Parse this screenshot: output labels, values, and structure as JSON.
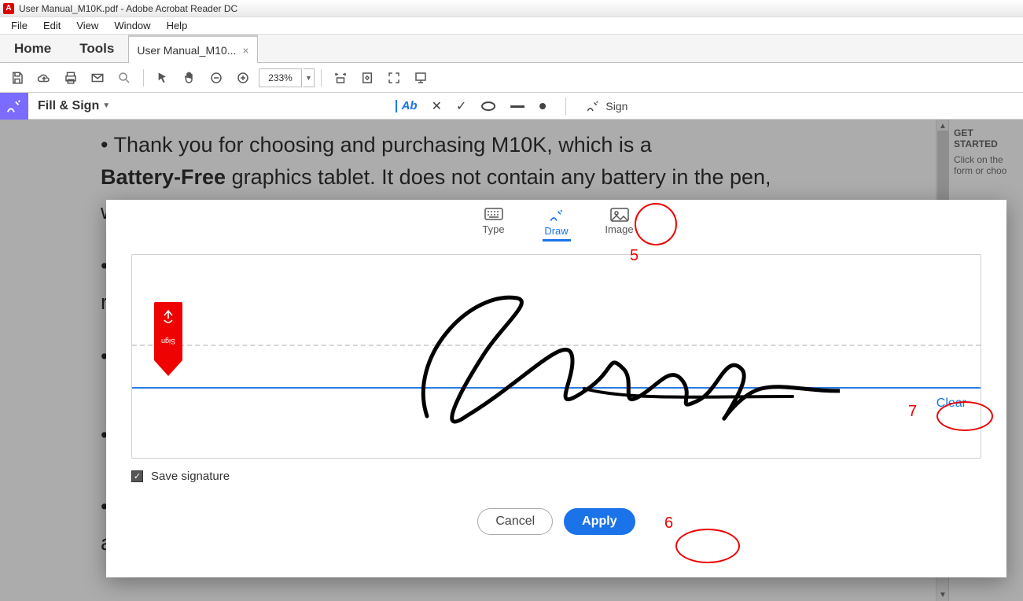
{
  "window": {
    "title": "User Manual_M10K.pdf - Adobe Acrobat Reader DC"
  },
  "menubar": {
    "file": "File",
    "edit": "Edit",
    "view": "View",
    "window": "Window",
    "help": "Help"
  },
  "tabs": {
    "home": "Home",
    "tools": "Tools",
    "doc": "User Manual_M10..."
  },
  "toolbar": {
    "zoom": "233%"
  },
  "fillbar": {
    "label": "Fill & Sign",
    "text_tool": "Ab",
    "sign": "Sign"
  },
  "document": {
    "line1a": "• Thank you for choosing and purchasing M10K, which is a",
    "line2a": "Battery-Free",
    "line2b": " graphics tablet. It does not contain any battery in the pen,",
    "w": "w",
    "r": "re",
    "a": "a"
  },
  "right_panel": {
    "head": "GET STARTED",
    "sub1": "Click on the",
    "sub2": "form or choo"
  },
  "sig_modal": {
    "tab_type": "Type",
    "tab_draw": "Draw",
    "tab_image": "Image",
    "clear": "Clear",
    "save_sig": "Save signature",
    "cancel": "Cancel",
    "apply": "Apply",
    "ribbon": "Sign"
  },
  "annotations": {
    "n5": "5",
    "n6": "6",
    "n7": "7"
  }
}
